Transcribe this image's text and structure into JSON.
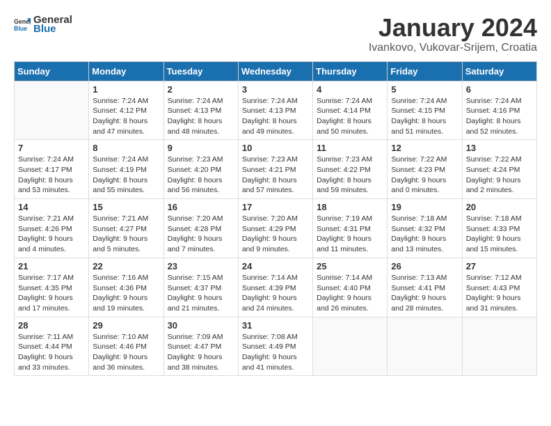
{
  "header": {
    "logo_general": "General",
    "logo_blue": "Blue",
    "title": "January 2024",
    "subtitle": "Ivankovo, Vukovar-Srijem, Croatia"
  },
  "days_of_week": [
    "Sunday",
    "Monday",
    "Tuesday",
    "Wednesday",
    "Thursday",
    "Friday",
    "Saturday"
  ],
  "weeks": [
    [
      {
        "day": "",
        "info": ""
      },
      {
        "day": "1",
        "info": "Sunrise: 7:24 AM\nSunset: 4:12 PM\nDaylight: 8 hours\nand 47 minutes."
      },
      {
        "day": "2",
        "info": "Sunrise: 7:24 AM\nSunset: 4:13 PM\nDaylight: 8 hours\nand 48 minutes."
      },
      {
        "day": "3",
        "info": "Sunrise: 7:24 AM\nSunset: 4:13 PM\nDaylight: 8 hours\nand 49 minutes."
      },
      {
        "day": "4",
        "info": "Sunrise: 7:24 AM\nSunset: 4:14 PM\nDaylight: 8 hours\nand 50 minutes."
      },
      {
        "day": "5",
        "info": "Sunrise: 7:24 AM\nSunset: 4:15 PM\nDaylight: 8 hours\nand 51 minutes."
      },
      {
        "day": "6",
        "info": "Sunrise: 7:24 AM\nSunset: 4:16 PM\nDaylight: 8 hours\nand 52 minutes."
      }
    ],
    [
      {
        "day": "7",
        "info": "Sunrise: 7:24 AM\nSunset: 4:17 PM\nDaylight: 8 hours\nand 53 minutes."
      },
      {
        "day": "8",
        "info": "Sunrise: 7:24 AM\nSunset: 4:19 PM\nDaylight: 8 hours\nand 55 minutes."
      },
      {
        "day": "9",
        "info": "Sunrise: 7:23 AM\nSunset: 4:20 PM\nDaylight: 8 hours\nand 56 minutes."
      },
      {
        "day": "10",
        "info": "Sunrise: 7:23 AM\nSunset: 4:21 PM\nDaylight: 8 hours\nand 57 minutes."
      },
      {
        "day": "11",
        "info": "Sunrise: 7:23 AM\nSunset: 4:22 PM\nDaylight: 8 hours\nand 59 minutes."
      },
      {
        "day": "12",
        "info": "Sunrise: 7:22 AM\nSunset: 4:23 PM\nDaylight: 9 hours\nand 0 minutes."
      },
      {
        "day": "13",
        "info": "Sunrise: 7:22 AM\nSunset: 4:24 PM\nDaylight: 9 hours\nand 2 minutes."
      }
    ],
    [
      {
        "day": "14",
        "info": "Sunrise: 7:21 AM\nSunset: 4:26 PM\nDaylight: 9 hours\nand 4 minutes."
      },
      {
        "day": "15",
        "info": "Sunrise: 7:21 AM\nSunset: 4:27 PM\nDaylight: 9 hours\nand 5 minutes."
      },
      {
        "day": "16",
        "info": "Sunrise: 7:20 AM\nSunset: 4:28 PM\nDaylight: 9 hours\nand 7 minutes."
      },
      {
        "day": "17",
        "info": "Sunrise: 7:20 AM\nSunset: 4:29 PM\nDaylight: 9 hours\nand 9 minutes."
      },
      {
        "day": "18",
        "info": "Sunrise: 7:19 AM\nSunset: 4:31 PM\nDaylight: 9 hours\nand 11 minutes."
      },
      {
        "day": "19",
        "info": "Sunrise: 7:18 AM\nSunset: 4:32 PM\nDaylight: 9 hours\nand 13 minutes."
      },
      {
        "day": "20",
        "info": "Sunrise: 7:18 AM\nSunset: 4:33 PM\nDaylight: 9 hours\nand 15 minutes."
      }
    ],
    [
      {
        "day": "21",
        "info": "Sunrise: 7:17 AM\nSunset: 4:35 PM\nDaylight: 9 hours\nand 17 minutes."
      },
      {
        "day": "22",
        "info": "Sunrise: 7:16 AM\nSunset: 4:36 PM\nDaylight: 9 hours\nand 19 minutes."
      },
      {
        "day": "23",
        "info": "Sunrise: 7:15 AM\nSunset: 4:37 PM\nDaylight: 9 hours\nand 21 minutes."
      },
      {
        "day": "24",
        "info": "Sunrise: 7:14 AM\nSunset: 4:39 PM\nDaylight: 9 hours\nand 24 minutes."
      },
      {
        "day": "25",
        "info": "Sunrise: 7:14 AM\nSunset: 4:40 PM\nDaylight: 9 hours\nand 26 minutes."
      },
      {
        "day": "26",
        "info": "Sunrise: 7:13 AM\nSunset: 4:41 PM\nDaylight: 9 hours\nand 28 minutes."
      },
      {
        "day": "27",
        "info": "Sunrise: 7:12 AM\nSunset: 4:43 PM\nDaylight: 9 hours\nand 31 minutes."
      }
    ],
    [
      {
        "day": "28",
        "info": "Sunrise: 7:11 AM\nSunset: 4:44 PM\nDaylight: 9 hours\nand 33 minutes."
      },
      {
        "day": "29",
        "info": "Sunrise: 7:10 AM\nSunset: 4:46 PM\nDaylight: 9 hours\nand 36 minutes."
      },
      {
        "day": "30",
        "info": "Sunrise: 7:09 AM\nSunset: 4:47 PM\nDaylight: 9 hours\nand 38 minutes."
      },
      {
        "day": "31",
        "info": "Sunrise: 7:08 AM\nSunset: 4:49 PM\nDaylight: 9 hours\nand 41 minutes."
      },
      {
        "day": "",
        "info": ""
      },
      {
        "day": "",
        "info": ""
      },
      {
        "day": "",
        "info": ""
      }
    ]
  ]
}
